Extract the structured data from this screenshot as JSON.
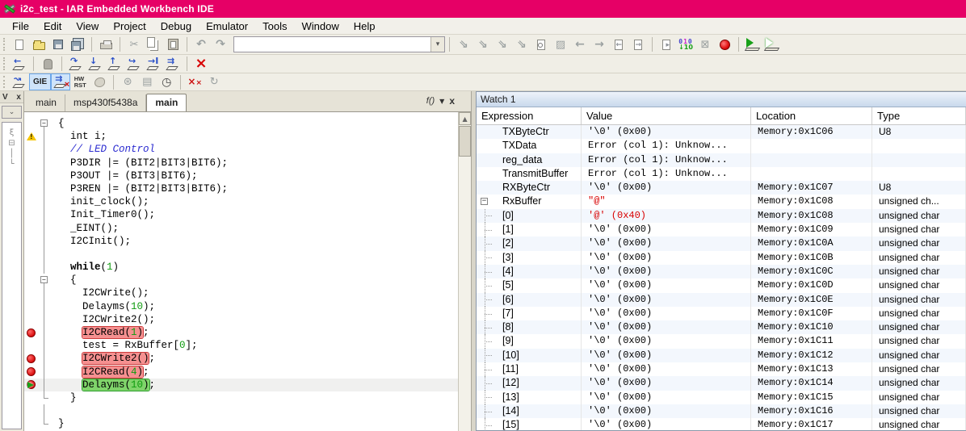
{
  "window": {
    "title": "i2c_test - IAR Embedded Workbench IDE"
  },
  "menu": {
    "items": [
      "File",
      "Edit",
      "View",
      "Project",
      "Debug",
      "Emulator",
      "Tools",
      "Window",
      "Help"
    ]
  },
  "toolbar1": [
    {
      "name": "new-document",
      "glyph": "page"
    },
    {
      "name": "open-file",
      "glyph": "folder"
    },
    {
      "name": "save",
      "glyph": "floppy",
      "disabled": true
    },
    {
      "name": "save-all",
      "glyph": "floppy-multi"
    },
    {
      "sep": true
    },
    {
      "name": "print",
      "glyph": "printer",
      "disabled": true
    },
    {
      "sep": true
    },
    {
      "name": "cut",
      "glyph": "scissors",
      "disabled": true
    },
    {
      "name": "copy",
      "glyph": "copy",
      "disabled": true
    },
    {
      "name": "paste",
      "glyph": "paste",
      "disabled": true
    },
    {
      "sep": true
    },
    {
      "name": "undo",
      "glyph": "undo",
      "disabled": true
    },
    {
      "name": "redo",
      "glyph": "redo",
      "disabled": true
    },
    {
      "combo": true,
      "name": "quick-search",
      "value": ""
    },
    {
      "sep": true
    },
    {
      "name": "navigate-tool-1",
      "glyph": "tool",
      "disabled": true
    },
    {
      "name": "navigate-tool-2",
      "glyph": "tool",
      "disabled": true
    },
    {
      "name": "navigate-tool-3",
      "glyph": "tool",
      "disabled": true
    },
    {
      "name": "navigate-tool-4",
      "glyph": "tool",
      "disabled": true
    },
    {
      "name": "find-in-file",
      "glyph": "doc-search",
      "disabled": true
    },
    {
      "name": "replace",
      "glyph": "hatch",
      "disabled": true
    },
    {
      "name": "navigate-back",
      "glyph": "arrow-left",
      "disabled": true
    },
    {
      "name": "navigate-forward",
      "glyph": "arrow-right",
      "disabled": true
    },
    {
      "name": "previous-document",
      "glyph": "doc-left",
      "disabled": true
    },
    {
      "name": "next-document",
      "glyph": "doc-right",
      "disabled": true
    },
    {
      "sep": true
    },
    {
      "name": "compile",
      "glyph": "doc-gear",
      "disabled": true
    },
    {
      "name": "make",
      "glyph": "bits"
    },
    {
      "name": "stop-build",
      "glyph": "cross-doc",
      "disabled": true
    },
    {
      "name": "toggle-breakpoint",
      "glyph": "red-ball"
    },
    {
      "sep": true
    },
    {
      "name": "download-and-debug",
      "glyph": "debug-go"
    },
    {
      "name": "debug-without-downloading",
      "glyph": "debug-go-outline"
    }
  ],
  "toolbar2": [
    {
      "name": "reset",
      "glyph": "dbg",
      "ch": "←"
    },
    {
      "sep": true
    },
    {
      "name": "break",
      "glyph": "hand",
      "disabled": true
    },
    {
      "sep": true
    },
    {
      "name": "step-over",
      "glyph": "dbg",
      "ch": "↷"
    },
    {
      "name": "step-into",
      "glyph": "dbg",
      "ch": "↓"
    },
    {
      "name": "step-out",
      "glyph": "dbg",
      "ch": "↑"
    },
    {
      "name": "next-statement",
      "glyph": "dbg",
      "ch": "↪"
    },
    {
      "name": "run-to-cursor",
      "glyph": "dbg",
      "ch": "→I"
    },
    {
      "name": "go",
      "glyph": "dbg",
      "ch": "⇉"
    },
    {
      "sep": true
    },
    {
      "name": "stop-debugging",
      "glyph": "stop-x"
    }
  ],
  "toolbar3": [
    {
      "name": "autostep",
      "glyph": "dbg",
      "ch": "↝"
    },
    {
      "name": "gie-toggle",
      "label": "GIE",
      "pressed": true
    },
    {
      "name": "interrupts-off",
      "glyph": "int-off",
      "pressed": true
    },
    {
      "name": "hw-reset",
      "label2": [
        "HW",
        "RST"
      ]
    },
    {
      "name": "macro",
      "glyph": "blob",
      "disabled": true
    },
    {
      "sep": true
    },
    {
      "name": "peripherals",
      "glyph": "wheel",
      "disabled": true
    },
    {
      "name": "register-view",
      "glyph": "table",
      "disabled": true
    },
    {
      "name": "cycle-counter",
      "glyph": "clock"
    },
    {
      "sep": true
    },
    {
      "name": "clear-all-breakpoints",
      "glyph": "xx"
    },
    {
      "name": "loop",
      "glyph": "loop",
      "disabled": true
    }
  ],
  "workspace": {
    "header_letter": "V",
    "close_label": "x"
  },
  "editor": {
    "tabs": [
      {
        "label": "main"
      },
      {
        "label": "msp430f5438a"
      },
      {
        "label": "main",
        "active": true
      }
    ],
    "fn_button_label": "f()",
    "dropdown_glyph": "▼",
    "close_glyph": "x",
    "lines": [
      {
        "fold": "box",
        "parts": [
          {
            "t": "{",
            "c": "pl"
          }
        ]
      },
      {
        "gutter": "warning",
        "parts": [
          {
            "t": "  int i;",
            "c": "pl"
          }
        ]
      },
      {
        "parts": [
          {
            "t": "  ",
            "c": "pl"
          },
          {
            "t": "// LED Control",
            "c": "cm"
          }
        ]
      },
      {
        "parts": [
          {
            "t": "  P3DIR |= (BIT2|BIT3|BIT6);",
            "c": "pl"
          }
        ]
      },
      {
        "parts": [
          {
            "t": "  P3OUT |= (BIT3|BIT6);",
            "c": "pl"
          }
        ]
      },
      {
        "parts": [
          {
            "t": "  P3REN |= (BIT2|BIT3|BIT6);",
            "c": "pl"
          }
        ]
      },
      {
        "parts": [
          {
            "t": "  init_clock();",
            "c": "pl"
          }
        ]
      },
      {
        "parts": [
          {
            "t": "  Init_Timer0();",
            "c": "pl"
          }
        ]
      },
      {
        "parts": [
          {
            "t": "  _EINT();",
            "c": "pl"
          }
        ]
      },
      {
        "parts": [
          {
            "t": "  I2CInit();",
            "c": "pl"
          }
        ]
      },
      {
        "parts": []
      },
      {
        "parts": [
          {
            "t": "  ",
            "c": "pl"
          },
          {
            "t": "while",
            "c": "kw"
          },
          {
            "t": "(",
            "c": "pl"
          },
          {
            "t": "1",
            "c": "num"
          },
          {
            "t": ")",
            "c": "pl"
          }
        ]
      },
      {
        "fold": "box",
        "parts": [
          {
            "t": "  {",
            "c": "pl"
          }
        ]
      },
      {
        "parts": [
          {
            "t": "    I2CWrite();",
            "c": "pl"
          }
        ]
      },
      {
        "parts": [
          {
            "t": "    Delayms(",
            "c": "pl"
          },
          {
            "t": "10",
            "c": "num"
          },
          {
            "t": ");",
            "c": "pl"
          }
        ]
      },
      {
        "parts": [
          {
            "t": "    I2CWrite2();",
            "c": "pl"
          }
        ]
      },
      {
        "gutter": "bp",
        "parts": [
          {
            "t": "    ",
            "c": "pl"
          },
          {
            "t": "I2CRead(",
            "c": "pl",
            "h": "r"
          },
          {
            "t": "1",
            "c": "num",
            "h": "r"
          },
          {
            "t": ")",
            "c": "pl",
            "h": "r"
          },
          {
            "t": ";",
            "c": "pl"
          }
        ]
      },
      {
        "parts": [
          {
            "t": "    test = RxBuffer[",
            "c": "pl"
          },
          {
            "t": "0",
            "c": "num"
          },
          {
            "t": "];",
            "c": "pl"
          }
        ]
      },
      {
        "gutter": "bp",
        "parts": [
          {
            "t": "    ",
            "c": "pl"
          },
          {
            "t": "I2CWrite2()",
            "c": "pl",
            "h": "r"
          },
          {
            "t": ";",
            "c": "pl"
          }
        ]
      },
      {
        "gutter": "bp",
        "parts": [
          {
            "t": "    ",
            "c": "pl"
          },
          {
            "t": "I2CRead(",
            "c": "pl",
            "h": "r"
          },
          {
            "t": "4",
            "c": "num",
            "h": "r"
          },
          {
            "t": ")",
            "c": "pl",
            "h": "r"
          },
          {
            "t": ";",
            "c": "pl"
          }
        ]
      },
      {
        "gutter": "bp-current",
        "bg": true,
        "parts": [
          {
            "t": "    ",
            "c": "pl"
          },
          {
            "t": "Delayms(",
            "c": "pl",
            "h": "g"
          },
          {
            "t": "10",
            "c": "num",
            "h": "g"
          },
          {
            "t": ")",
            "c": "pl",
            "h": "g"
          },
          {
            "t": ";",
            "c": "pl"
          }
        ]
      },
      {
        "fold": "end",
        "parts": [
          {
            "t": "  }",
            "c": "pl"
          }
        ]
      },
      {
        "parts": []
      },
      {
        "fold": "end",
        "parts": [
          {
            "t": "}",
            "c": "pl"
          }
        ]
      }
    ]
  },
  "watch": {
    "title": "Watch 1",
    "columns": [
      "Expression",
      "Value",
      "Location",
      "Type"
    ],
    "rows": [
      {
        "expr": "TXByteCtr",
        "value": "'\\0'  (0x00)",
        "location": "Memory:0x1C06",
        "type": "U8"
      },
      {
        "expr": "TXData",
        "value": "Error (col 1): Unknow...",
        "location": "",
        "type": ""
      },
      {
        "expr": "reg_data",
        "value": "Error (col 1): Unknow...",
        "location": "",
        "type": ""
      },
      {
        "expr": "TransmitBuffer",
        "value": "Error (col 1): Unknow...",
        "location": "",
        "type": ""
      },
      {
        "expr": "RXByteCtr",
        "value": "'\\0'  (0x00)",
        "location": "Memory:0x1C07",
        "type": "U8"
      },
      {
        "expr": "RxBuffer",
        "value": "\"@\"",
        "red": true,
        "location": "Memory:0x1C08",
        "type": "unsigned ch...",
        "expander": true
      },
      {
        "expr": "[0]",
        "value": "'@'  (0x40)",
        "red": true,
        "location": "Memory:0x1C08",
        "type": "unsigned char",
        "child": true
      },
      {
        "expr": "[1]",
        "value": "'\\0'  (0x00)",
        "location": "Memory:0x1C09",
        "type": "unsigned char",
        "child": true
      },
      {
        "expr": "[2]",
        "value": "'\\0'  (0x00)",
        "location": "Memory:0x1C0A",
        "type": "unsigned char",
        "child": true
      },
      {
        "expr": "[3]",
        "value": "'\\0'  (0x00)",
        "location": "Memory:0x1C0B",
        "type": "unsigned char",
        "child": true
      },
      {
        "expr": "[4]",
        "value": "'\\0'  (0x00)",
        "location": "Memory:0x1C0C",
        "type": "unsigned char",
        "child": true
      },
      {
        "expr": "[5]",
        "value": "'\\0'  (0x00)",
        "location": "Memory:0x1C0D",
        "type": "unsigned char",
        "child": true
      },
      {
        "expr": "[6]",
        "value": "'\\0'  (0x00)",
        "location": "Memory:0x1C0E",
        "type": "unsigned char",
        "child": true
      },
      {
        "expr": "[7]",
        "value": "'\\0'  (0x00)",
        "location": "Memory:0x1C0F",
        "type": "unsigned char",
        "child": true
      },
      {
        "expr": "[8]",
        "value": "'\\0'  (0x00)",
        "location": "Memory:0x1C10",
        "type": "unsigned char",
        "child": true
      },
      {
        "expr": "[9]",
        "value": "'\\0'  (0x00)",
        "location": "Memory:0x1C11",
        "type": "unsigned char",
        "child": true
      },
      {
        "expr": "[10]",
        "value": "'\\0'  (0x00)",
        "location": "Memory:0x1C12",
        "type": "unsigned char",
        "child": true
      },
      {
        "expr": "[11]",
        "value": "'\\0'  (0x00)",
        "location": "Memory:0x1C13",
        "type": "unsigned char",
        "child": true
      },
      {
        "expr": "[12]",
        "value": "'\\0'  (0x00)",
        "location": "Memory:0x1C14",
        "type": "unsigned char",
        "child": true
      },
      {
        "expr": "[13]",
        "value": "'\\0'  (0x00)",
        "location": "Memory:0x1C15",
        "type": "unsigned char",
        "child": true
      },
      {
        "expr": "[14]",
        "value": "'\\0'  (0x00)",
        "location": "Memory:0x1C16",
        "type": "unsigned char",
        "child": true
      },
      {
        "expr": "[15]",
        "value": "'\\0'  (0x00)",
        "location": "Memory:0x1C17",
        "type": "unsigned char",
        "child": true
      }
    ]
  },
  "colors": {
    "titlebar": "#e60066",
    "breakpoint": "#dd1414",
    "breakpoint_highlight": "#f59090",
    "breakpoint_highlight_border": "#cc3c3c",
    "current_statement_highlight": "#7fd46a",
    "current_statement_border": "#2f9e2f",
    "number_token": "#0f9b0f",
    "comment_token": "#2b2bd0",
    "pressed_button": "#cfe4fa"
  }
}
